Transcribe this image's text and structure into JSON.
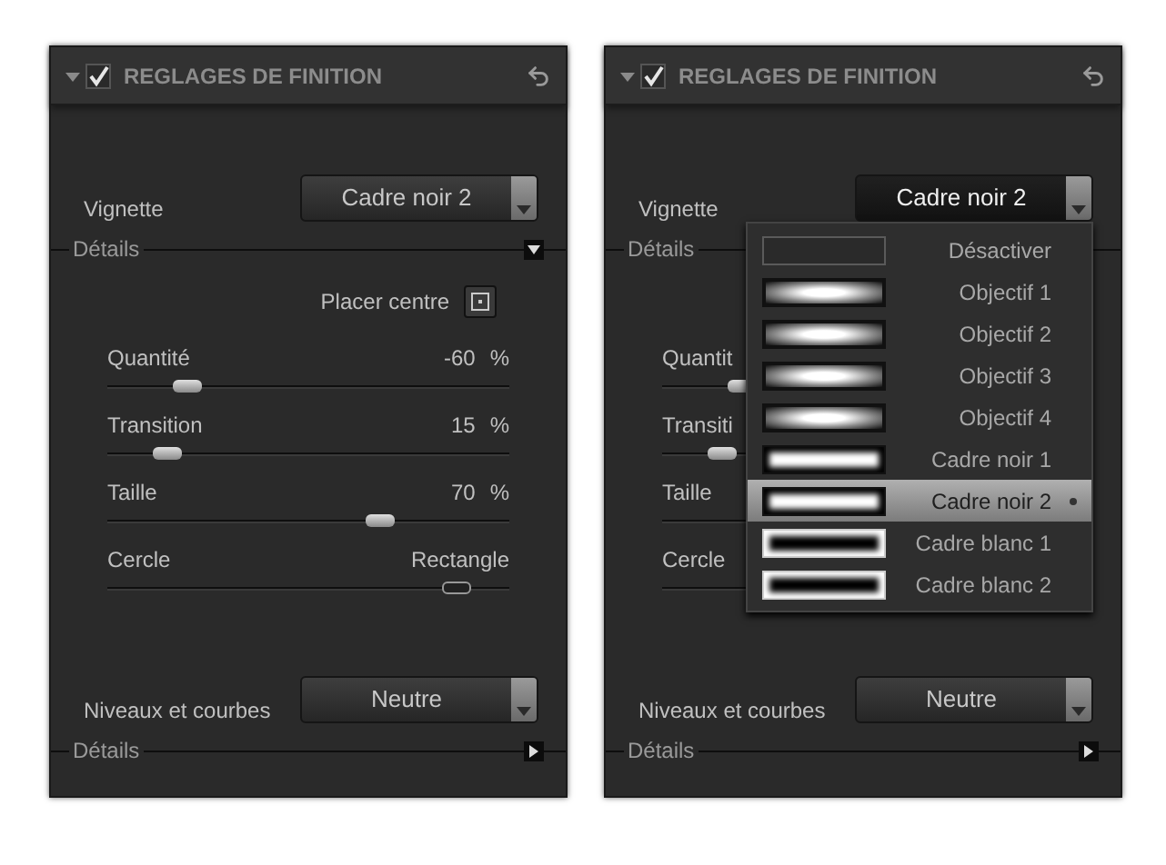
{
  "panels": [
    {
      "header": {
        "title": "REGLAGES DE FINITION",
        "enabled": true,
        "expanded": true
      },
      "vignette": {
        "label": "Vignette",
        "value": "Cadre noir 2",
        "open": false
      },
      "details": {
        "label": "Détails",
        "expanded": true
      },
      "center": {
        "label": "Placer centre"
      },
      "sliders": [
        {
          "kind": "percent",
          "label": "Quantité",
          "value": "-60",
          "unit": "%",
          "level": 0.2
        },
        {
          "kind": "percent",
          "label": "Transition",
          "value": "15",
          "unit": "%",
          "level": 0.15
        },
        {
          "kind": "percent",
          "label": "Taille",
          "value": "70",
          "unit": "%",
          "level": 0.68
        },
        {
          "kind": "balance",
          "label": "Cercle",
          "right_label": "Rectangle",
          "level": 0.87
        }
      ],
      "levels": {
        "label": "Niveaux et courbes",
        "value": "Neutre"
      },
      "details_2": {
        "label": "Détails",
        "expanded": false
      }
    },
    {
      "header": {
        "title": "REGLAGES DE FINITION",
        "enabled": true,
        "expanded": true
      },
      "vignette": {
        "label": "Vignette",
        "value": "Cadre noir 2",
        "open": true,
        "menu": [
          {
            "label": "Désactiver",
            "kind": "none",
            "selected": false
          },
          {
            "label": "Objectif 1",
            "kind": "lens",
            "selected": false
          },
          {
            "label": "Objectif 2",
            "kind": "lens",
            "selected": false
          },
          {
            "label": "Objectif 3",
            "kind": "lens",
            "selected": false
          },
          {
            "label": "Objectif 4",
            "kind": "lens",
            "selected": false
          },
          {
            "label": "Cadre noir 1",
            "kind": "black_frame",
            "selected": false
          },
          {
            "label": "Cadre noir 2",
            "kind": "black_frame",
            "selected": true
          },
          {
            "label": "Cadre blanc 1",
            "kind": "white_frame",
            "selected": false
          },
          {
            "label": "Cadre blanc 2",
            "kind": "white_frame",
            "selected": false
          }
        ]
      },
      "details": {
        "label": "Détails"
      },
      "sliders": [
        {
          "kind": "percent",
          "label": "Quantit",
          "level": 0.2
        },
        {
          "kind": "percent",
          "label": "Transiti",
          "level": 0.15
        },
        {
          "kind": "percent",
          "label": "Taille"
        },
        {
          "kind": "balance",
          "label": "Cercle"
        }
      ],
      "levels": {
        "label": "Niveaux et courbes",
        "value": "Neutre"
      },
      "details_2": {
        "label": "Détails",
        "expanded": false
      }
    }
  ]
}
